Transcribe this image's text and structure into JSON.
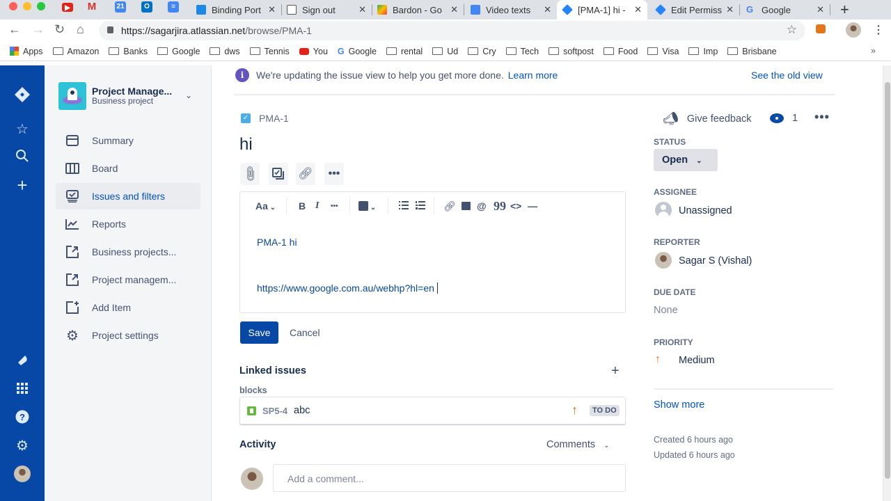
{
  "browser": {
    "tabs": [
      {
        "title": "Binding Port",
        "icon": "slash-app-icon",
        "active": false
      },
      {
        "title": "Sign out",
        "icon": "document-icon",
        "active": false
      },
      {
        "title": "Bardon - Go",
        "icon": "google-maps-icon",
        "active": false
      },
      {
        "title": "Video texts",
        "icon": "google-docs-icon",
        "active": false
      },
      {
        "title": "[PMA-1] hi -",
        "icon": "jira-icon",
        "active": true
      },
      {
        "title": "Edit Permiss",
        "icon": "jira-icon",
        "active": false
      },
      {
        "title": "Google",
        "icon": "google-icon",
        "active": false
      }
    ],
    "pinned": [
      "youtube-icon",
      "gmail-icon",
      "calendar-icon",
      "outlook-icon",
      "google-docs-icon"
    ],
    "calendar_day": "21",
    "url_host": "https://sagarjira.atlassian.net",
    "url_path": "/browse/PMA-1",
    "bookmarks": [
      "Apps",
      "Amazon",
      "Banks",
      "Google",
      "dws",
      "Tennis",
      "You",
      "Google",
      "rental",
      "Ud",
      "Cry",
      "Tech",
      "softpost",
      "Food",
      "Visa",
      "Imp",
      "Brisbane"
    ],
    "bookmarks_overflow": "»"
  },
  "project": {
    "name": "Project Manage...",
    "type": "Business project",
    "nav": [
      {
        "label": "Summary",
        "icon": "summary-icon"
      },
      {
        "label": "Board",
        "icon": "board-icon"
      },
      {
        "label": "Issues and filters",
        "icon": "issues-icon",
        "selected": true
      },
      {
        "label": "Reports",
        "icon": "reports-icon"
      },
      {
        "label": "Business projects...",
        "icon": "external-link-icon"
      },
      {
        "label": "Project managem...",
        "icon": "external-link-icon"
      },
      {
        "label": "Add Item",
        "icon": "add-item-icon"
      },
      {
        "label": "Project settings",
        "icon": "gear-icon"
      }
    ]
  },
  "banner": {
    "text": "We're updating the issue view to help you get more done.",
    "link": "Learn more",
    "old_view": "See the old view"
  },
  "issue": {
    "key": "PMA-1",
    "title": "hi",
    "description_lines": [
      "PMA-1 hi",
      "https://www.google.com.au/webhp?hl=en"
    ],
    "toolbar": {
      "text_style": "Aa",
      "bold": "B",
      "italic": "I",
      "more": "•••",
      "quote": "99",
      "code": "<>",
      "rule": "—"
    },
    "save_label": "Save",
    "cancel_label": "Cancel",
    "linked_issues_title": "Linked issues",
    "link_type": "blocks",
    "linked": {
      "key": "SP5-4",
      "summary": "abc",
      "status": "TO DO",
      "priority": "high"
    },
    "activity_title": "Activity",
    "activity_filter": "Comments",
    "comment_placeholder": "Add a comment..."
  },
  "details": {
    "give_feedback": "Give feedback",
    "watchers": "1",
    "status_label": "STATUS",
    "status": "Open",
    "assignee_label": "ASSIGNEE",
    "assignee": "Unassigned",
    "reporter_label": "REPORTER",
    "reporter": "Sagar S (Vishal)",
    "due_label": "DUE DATE",
    "due": "None",
    "priority_label": "PRIORITY",
    "priority": "Medium",
    "show_more": "Show more",
    "created": "Created 6 hours ago",
    "updated": "Updated 6 hours ago"
  },
  "colors": {
    "global_nav": "#0747a6",
    "link": "#0052cc",
    "priority_medium": "#e06b18",
    "story": "#63ba3c"
  }
}
